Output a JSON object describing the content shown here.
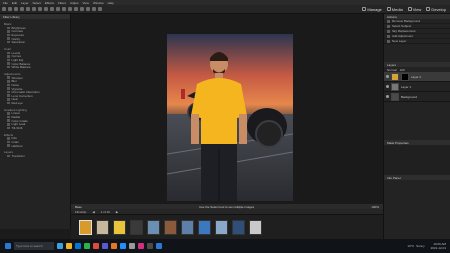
{
  "app": {
    "menus": [
      "File",
      "Edit",
      "Layer",
      "Select",
      "Effects",
      "Filters",
      "Adjust",
      "View",
      "Window",
      "Help"
    ],
    "mode_buttons": [
      {
        "label": "Manage",
        "icon": "grid-icon"
      },
      {
        "label": "Media",
        "icon": "media-icon"
      },
      {
        "label": "View",
        "icon": "eye-icon"
      },
      {
        "label": "Develop",
        "icon": "develop-icon"
      }
    ]
  },
  "left_panel": {
    "title": "Filter Library",
    "sections": [
      {
        "name": "Basic",
        "items": [
          "Brightness",
          "Contrast",
          "Exposure",
          "Clarity",
          "Saturation"
        ]
      },
      {
        "name": "Color",
        "items": [
          "Levels",
          "Curves",
          "Light EQ",
          "Color Balance",
          "White Balance"
        ]
      },
      {
        "name": "Adjustments",
        "items": [
          "Sharpen",
          "Blur",
          "Noise",
          "Vignette",
          "Chromatic Aberration",
          "Lens Correction",
          "Heal",
          "Red-eye"
        ]
      },
      {
        "name": "Gradient Lighting",
        "items": [
          "Linear",
          "Radial",
          "Color Grade",
          "Light Leak",
          "Tilt-Shift"
        ]
      },
      {
        "name": "Effects",
        "items": [
          "Film",
          "Grain",
          "Halftone"
        ]
      },
      {
        "name": "Layers",
        "items": [
          "Transform"
        ]
      }
    ]
  },
  "canvas": {
    "status_left": "Base",
    "status_center": "Use the Select tool to set multiple images",
    "status_right": "100%"
  },
  "filmstrip": {
    "tab_label": "Filmstrip",
    "page_info": "1 of 10",
    "thumbnails": [
      {
        "color": "#d89a2a"
      },
      {
        "color": "#c6b89a"
      },
      {
        "color": "#e9c43a"
      },
      {
        "color": "#3a3a3a"
      },
      {
        "color": "#6a8fb3"
      },
      {
        "color": "#8a5a3a"
      },
      {
        "color": "#5e7fa8"
      },
      {
        "color": "#3c78c0"
      },
      {
        "color": "#8aa9c9"
      },
      {
        "color": "#2f4f7a"
      },
      {
        "color": "#c9c9c9"
      }
    ]
  },
  "right_panel": {
    "title": "Actions",
    "actions": [
      "Remove Background",
      "Select Subject",
      "Sky Replacement",
      "Add Adjustment",
      "New Layer"
    ],
    "layers_title": "Layers",
    "layers": [
      {
        "name": "Layer 2",
        "thumb_color": "#d8a23b",
        "selected": true
      },
      {
        "name": "Layer 1",
        "thumb_color": "#777777",
        "selected": false
      },
      {
        "name": "Background",
        "thumb_color": "#4a4a4a",
        "selected": false
      }
    ],
    "blend_mode": "Normal",
    "opacity": "100",
    "properties_title": "Mask Properties",
    "info_title": "Info Panel"
  },
  "taskbar": {
    "search_placeholder": "Type here to search",
    "temperature": "19°C",
    "weather": "Sunny",
    "time": "10:06 AM",
    "date": "2021-12-01",
    "apps": [
      {
        "color": "#3aa0e0"
      },
      {
        "color": "#f0b429"
      },
      {
        "color": "#0078d7"
      },
      {
        "color": "#2bb24c"
      },
      {
        "color": "#e04a3a"
      },
      {
        "color": "#5a5ad0"
      },
      {
        "color": "#e07a2a"
      },
      {
        "color": "#1e90ff"
      },
      {
        "color": "#9a9a9a"
      },
      {
        "color": "#d12f80"
      },
      {
        "color": "#4a4a4a"
      },
      {
        "color": "#2a7ad0"
      }
    ]
  }
}
